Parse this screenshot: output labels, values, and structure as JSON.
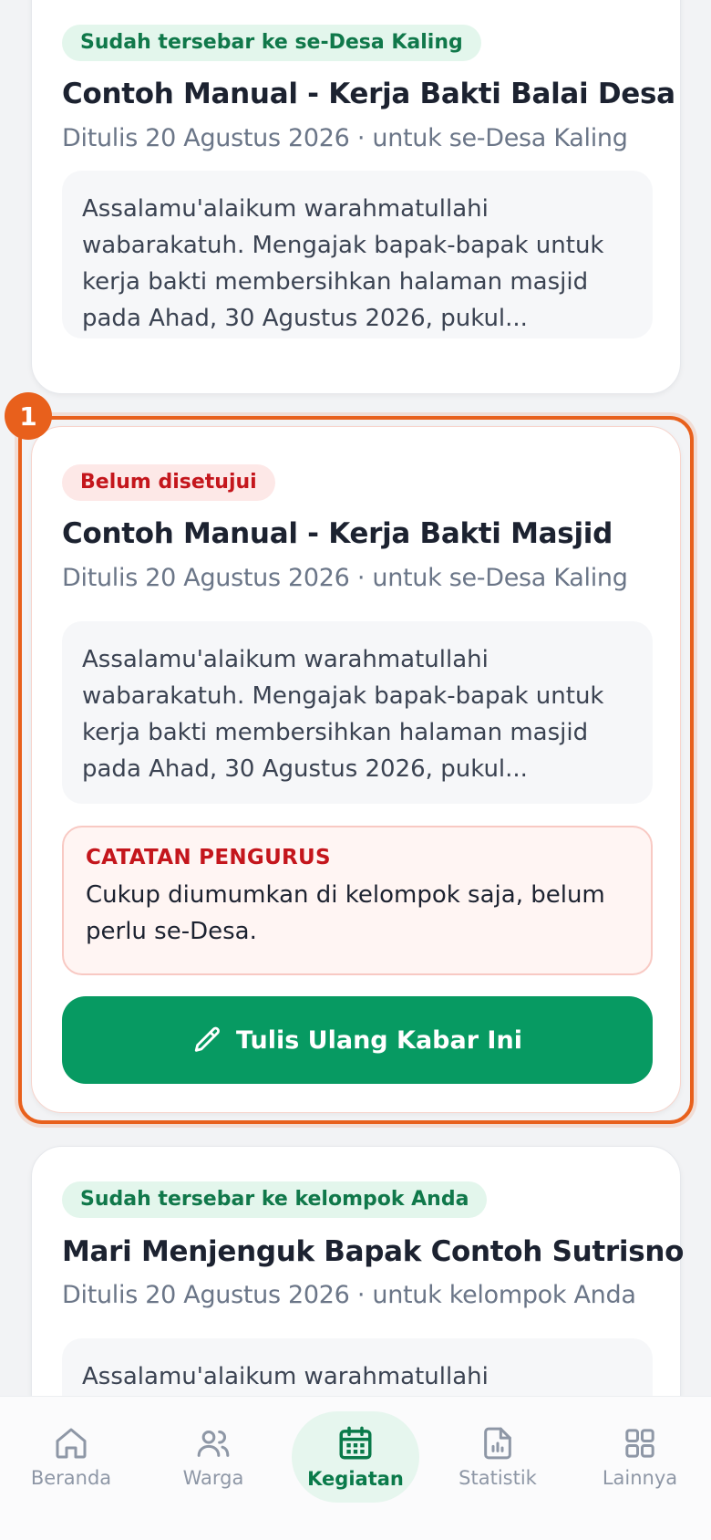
{
  "cards": [
    {
      "status": "Sudah tersebar ke se-Desa Kaling",
      "title": "Contoh Manual - Kerja Bakti Balai Desa",
      "meta": "Ditulis 20 Agustus 2026 · untuk se-Desa Kaling",
      "excerpt": "Assalamu'alaikum warahmatullahi wabarakatuh. Mengajak bapak-bapak untuk kerja bakti membersihkan halaman masjid pada Ahad, 30 Agustus 2026, pukul..."
    },
    {
      "status": "Belum disetujui",
      "title": "Contoh Manual - Kerja Bakti Masjid",
      "meta": "Ditulis 20 Agustus 2026 · untuk se-Desa Kaling",
      "excerpt": "Assalamu'alaikum warahmatullahi wabarakatuh. Mengajak bapak-bapak untuk kerja bakti membersihkan halaman masjid pada Ahad, 30 Agustus 2026, pukul...",
      "note_label": "CATATAN PENGURUS",
      "note_text": "Cukup diumumkan di kelompok saja, belum perlu se-Desa.",
      "action_label": "Tulis Ulang Kabar Ini"
    },
    {
      "status": "Sudah tersebar ke kelompok Anda",
      "title": "Mari Menjenguk Bapak Contoh Sutrisno",
      "meta": "Ditulis 20 Agustus 2026 · untuk kelompok Anda",
      "excerpt": "Assalamu'alaikum warahmatullahi"
    }
  ],
  "step_marker": "1",
  "nav": {
    "items": [
      {
        "label": "Beranda",
        "icon": "home-icon"
      },
      {
        "label": "Warga",
        "icon": "users-icon"
      },
      {
        "label": "Kegiatan",
        "icon": "calendar-icon",
        "active": true
      },
      {
        "label": "Statistik",
        "icon": "chart-file-icon"
      },
      {
        "label": "Lainnya",
        "icon": "grid-icon"
      }
    ]
  },
  "colors": {
    "primary_green": "#079a62",
    "highlight_orange": "#e8601c",
    "danger_red": "#c4161c"
  }
}
